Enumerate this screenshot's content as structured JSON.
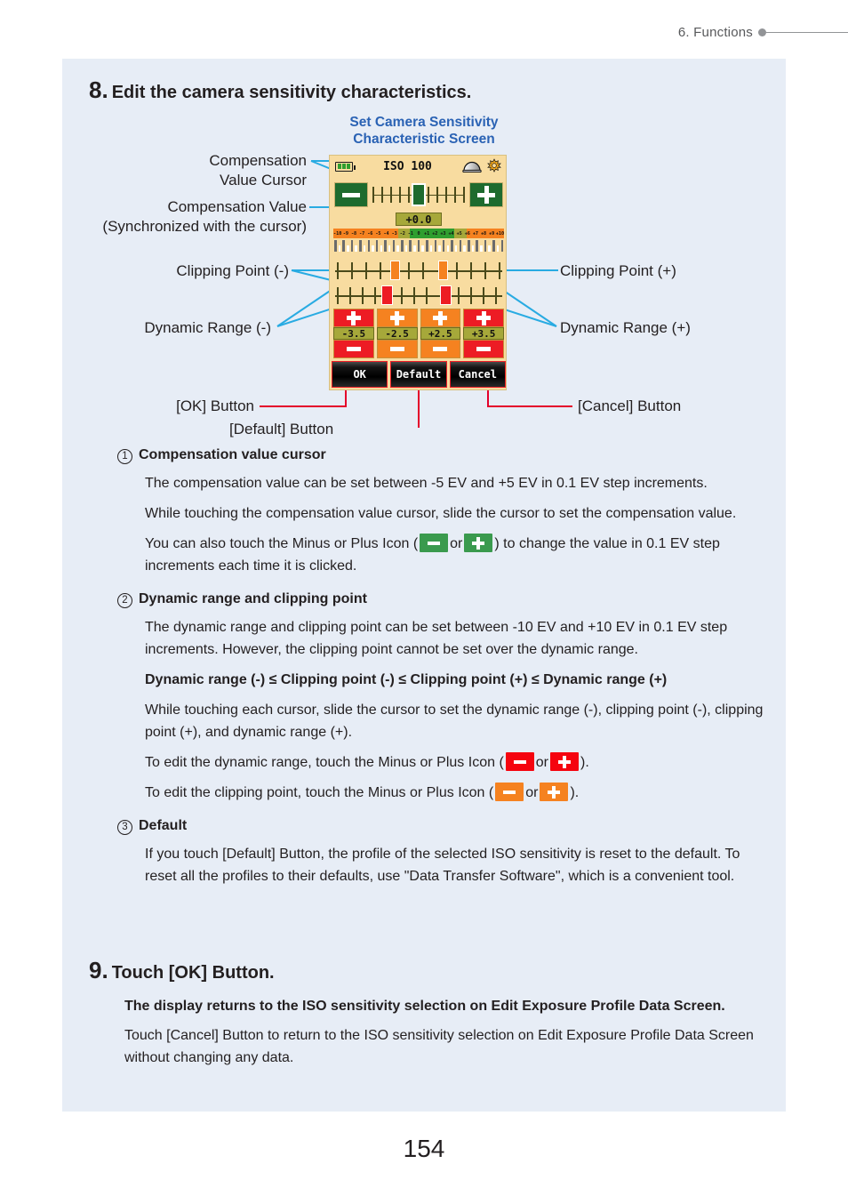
{
  "header": {
    "chapter": "6.  Functions"
  },
  "page_number": "154",
  "step8": {
    "number": "8.",
    "title": "Edit the camera sensitivity characteristics."
  },
  "step9": {
    "number": "9.",
    "title": "Touch [OK] Button.",
    "bold_text": "The display returns to the ISO sensitivity selection on Edit Exposure Profile Data Screen.",
    "text": "Touch [Cancel] Button to return to the ISO sensitivity selection on Edit Exposure Profile Data Screen without changing any data."
  },
  "figure": {
    "caption_line1": "Set Camera Sensitivity",
    "caption_line2": "Characteristic Screen",
    "callouts": {
      "compensation_value_cursor": "Compensation\nValue Cursor",
      "compensation_value": "Compensation Value\n(Synchronized with the cursor)",
      "clipping_point_minus": "Clipping Point (-)",
      "clipping_point_plus": "Clipping Point (+)",
      "dynamic_range_minus": "Dynamic Range (-)",
      "dynamic_range_plus": "Dynamic Range (+)",
      "ok_button": "[OK] Button",
      "default_button": "[Default] Button",
      "cancel_button": "[Cancel] Button"
    },
    "device": {
      "iso_label": "ISO 100",
      "compensation_value": "+0.0",
      "scale_labels": [
        "-10",
        "-9",
        "-8",
        "-7",
        "-6",
        "-5",
        "-4",
        "-3",
        "-2",
        "-1",
        "0",
        "+1",
        "+2",
        "+3",
        "+4",
        "+5",
        "+6",
        "+7",
        "+8",
        "+9",
        "+10"
      ],
      "steppers": [
        {
          "name": "dynamic-range-minus",
          "value": "-3.5",
          "color": "#ed1c24"
        },
        {
          "name": "clipping-point-minus",
          "value": "-2.5",
          "color": "#f58220"
        },
        {
          "name": "clipping-point-plus",
          "value": "+2.5",
          "color": "#f58220"
        },
        {
          "name": "dynamic-range-plus",
          "value": "+3.5",
          "color": "#ed1c24"
        }
      ],
      "buttons": {
        "ok": "OK",
        "default": "Default",
        "cancel": "Cancel"
      }
    }
  },
  "items": [
    {
      "marker": "1",
      "title": "Compensation value cursor",
      "paragraphs": [
        "The compensation value can be set between -5 EV and +5 EV in 0.1 EV step increments.",
        "While touching the compensation value cursor, slide the cursor to set the compensation value."
      ],
      "icon_paragraph_pre": "You can also touch the Minus or Plus Icon (",
      "icon_paragraph_mid": "or",
      "icon_paragraph_post": ") to change the value in 0.1 EV step increments each time it is clicked."
    },
    {
      "marker": "2",
      "title": "Dynamic range and clipping point",
      "paragraphs": [
        "The dynamic range and clipping point can be set between -10 EV and +10 EV in 0.1 EV step increments. However, the clipping point cannot be set over the dynamic range."
      ],
      "bold_rule": "Dynamic range (-) ≤ Clipping point (-) ≤ Clipping point (+) ≤ Dynamic range (+)",
      "paragraph2": "While touching each cursor, slide the cursor to set the dynamic range (-), clipping point (-), clipping point (+), and dynamic range (+).",
      "dr_pre": "To edit the dynamic range, touch the Minus or Plus Icon (",
      "dr_mid": "or",
      "dr_post": ").",
      "cp_pre": "To edit the clipping point, touch the Minus or Plus Icon (",
      "cp_mid": "or",
      "cp_post": ")."
    },
    {
      "marker": "3",
      "title": "Default",
      "paragraphs": [
        "If you touch [Default] Button, the profile of the selected ISO sensitivity is reset to the default. To reset all the profiles to their defaults, use \"Data Transfer Software\", which is a convenient tool."
      ]
    }
  ],
  "colors": {
    "panel_bg": "#e7edf6",
    "caption_blue": "#2a62b4",
    "leader_cyan": "#29abe2",
    "leader_red": "#e4002b",
    "device_bg": "#f8dca0",
    "green": "#1e6b2e",
    "orange": "#f58220",
    "red": "#ed1c24",
    "olive": "#a6a83a"
  }
}
